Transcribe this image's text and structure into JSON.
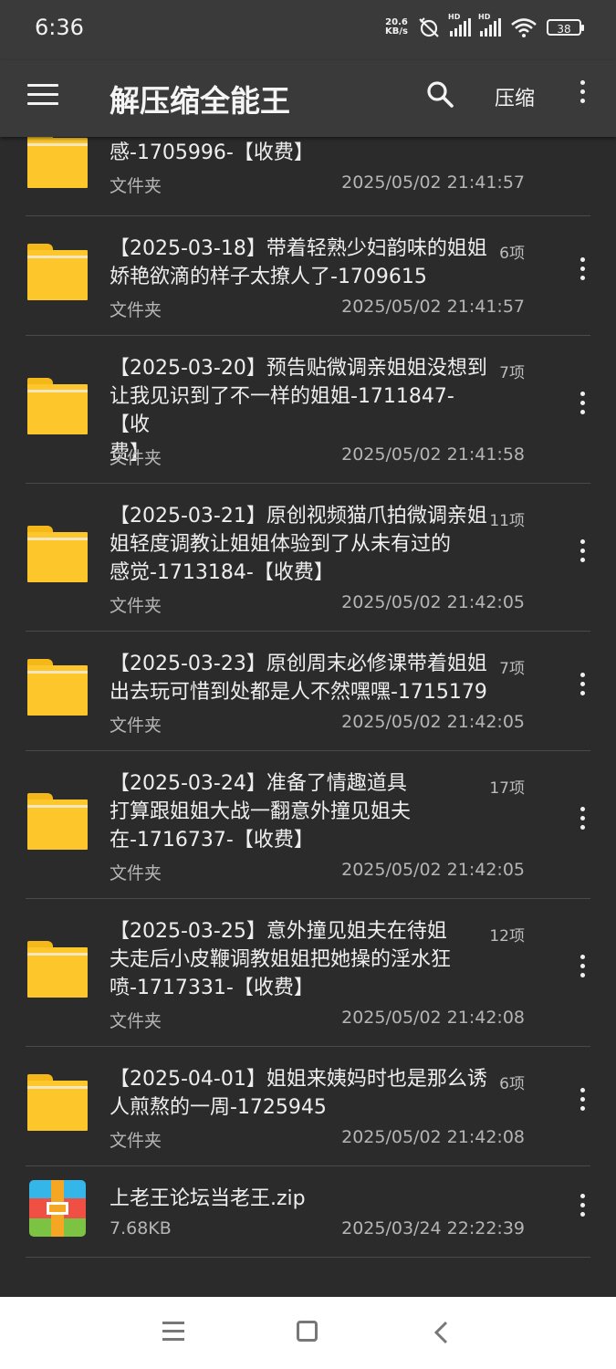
{
  "status_bar": {
    "time": "6:36",
    "net_speed_value": "20.6",
    "net_speed_unit": "KB/s",
    "hd_label": "HD",
    "battery": "38"
  },
  "app_bar": {
    "title": "解压缩全能王",
    "compress_label": "压缩"
  },
  "files": [
    {
      "kind": "folder",
      "name_lines": [
        "感-1705996-【收费】"
      ],
      "count": "",
      "type": "文件夹",
      "date": "2025/05/02 21:41:57"
    },
    {
      "kind": "folder",
      "name_lines": [
        "【2025-03-18】带着轻熟少妇韵味的姐姐",
        "娇艳欲滴的样子太撩人了-1709615"
      ],
      "count": "6项",
      "type": "文件夹",
      "date": "2025/05/02 21:41:57"
    },
    {
      "kind": "folder",
      "name_lines": [
        "【2025-03-20】预告贴微调亲姐姐没想到",
        "让我见识到了不一样的姐姐-1711847-【收",
        "费】"
      ],
      "count": "7项",
      "type": "文件夹",
      "date": "2025/05/02 21:41:58"
    },
    {
      "kind": "folder",
      "name_lines": [
        "【2025-03-21】原创视频猫爪拍微调亲姐",
        "姐轻度调教让姐姐体验到了从未有过的",
        "感觉-1713184-【收费】"
      ],
      "count": "11项",
      "type": "文件夹",
      "date": "2025/05/02 21:42:05"
    },
    {
      "kind": "folder",
      "name_lines": [
        "【2025-03-23】原创周末必修课带着姐姐",
        "出去玩可惜到处都是人不然嘿嘿-1715179"
      ],
      "count": "7项",
      "type": "文件夹",
      "date": "2025/05/02 21:42:05"
    },
    {
      "kind": "folder",
      "name_lines": [
        "【2025-03-24】准备了情趣道具",
        "打算跟姐姐大战一翻意外撞见姐夫",
        "在-1716737-【收费】"
      ],
      "count": "17项",
      "type": "文件夹",
      "date": "2025/05/02 21:42:05"
    },
    {
      "kind": "folder",
      "name_lines": [
        "【2025-03-25】意外撞见姐夫在待姐",
        "夫走后小皮鞭调教姐姐把她操的淫水狂",
        "喷-1717331-【收费】"
      ],
      "count": "12项",
      "type": "文件夹",
      "date": "2025/05/02 21:42:08"
    },
    {
      "kind": "folder",
      "name_lines": [
        "【2025-04-01】姐姐来姨妈时也是那么诱",
        "人煎熬的一周-1725945"
      ],
      "count": "6项",
      "type": "文件夹",
      "date": "2025/05/02 21:42:08"
    },
    {
      "kind": "zip",
      "name_lines": [
        "上老王论坛当老王.zip"
      ],
      "count": "",
      "type": "7.68KB",
      "date": "2025/03/24 22:22:39"
    }
  ],
  "icons": {
    "menu": "menu-icon",
    "search": "search-icon",
    "more": "more-vert-icon",
    "folder": "folder-icon",
    "zip": "zip-archive-icon"
  },
  "colors": {
    "background": "#2b2b2b",
    "app_bar": "#3a3a3a",
    "folder": "#fdc72c",
    "divider": "#4a4a4a",
    "nav_bar": "#ffffff"
  }
}
